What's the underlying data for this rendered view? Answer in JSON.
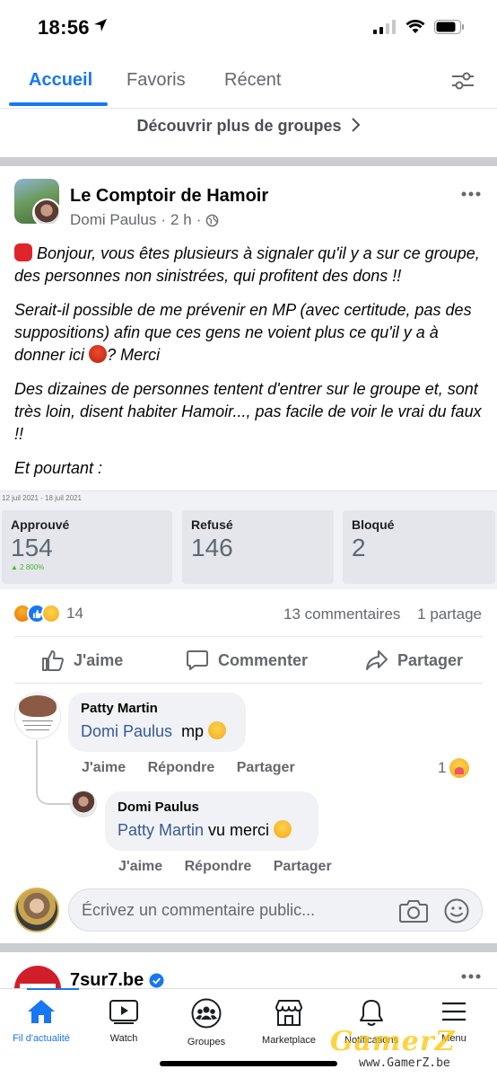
{
  "status_bar": {
    "time": "18:56"
  },
  "tabs": [
    {
      "label": "Accueil",
      "active": true
    },
    {
      "label": "Favoris",
      "active": false
    },
    {
      "label": "Récent",
      "active": false
    }
  ],
  "discover": {
    "label": "Découvrir plus de groupes"
  },
  "post": {
    "group_name": "Le Comptoir de Hamoir",
    "author": "Domi Paulus",
    "time": "2 h",
    "paragraphs": [
      "Bonjour, vous êtes plusieurs à signaler qu'il y a sur ce groupe, des personnes non sinistrées, qui profitent des dons !!",
      "Serait-il possible de me prévenir en MP (avec certitude, pas des suppositions) afin que ces gens ne voient plus ce qu'il y a à donner ici",
      "? Merci",
      "Des dizaines de personnes tentent d'entrer sur le groupe et, sont très loin, disent habiter Hamoir..., pas facile de voir le vrai du faux !!",
      "Et pourtant :"
    ],
    "stats_image": {
      "date_range": "12 juil 2021 - 18 juil 2021",
      "cards": [
        {
          "label": "Approuvé",
          "value": "154",
          "change": "▲ 2 800%"
        },
        {
          "label": "Refusé",
          "value": "146",
          "change": ""
        },
        {
          "label": "Bloqué",
          "value": "2",
          "change": ""
        }
      ]
    },
    "reaction_count": "14",
    "comments_count": "13 commentaires",
    "shares_count": "1 partage",
    "actions": {
      "like": "J'aime",
      "comment": "Commenter",
      "share": "Partager"
    }
  },
  "comments": [
    {
      "name": "Patty Martin",
      "mention": "Domi Paulus",
      "text": "mp",
      "actions": [
        "J'aime",
        "Répondre",
        "Partager"
      ],
      "reaction_count": "1"
    },
    {
      "name": "Domi Paulus",
      "mention": "Patty Martin",
      "text": "vu merci",
      "actions": [
        "J'aime",
        "Répondre",
        "Partager"
      ]
    }
  ],
  "composer": {
    "placeholder": "Écrivez un commentaire public..."
  },
  "next_post": {
    "name": "7sur7.be"
  },
  "bottom_nav": [
    {
      "label": "Fil d'actualité",
      "icon": "home-icon",
      "active": true
    },
    {
      "label": "Watch",
      "icon": "watch-icon",
      "active": false
    },
    {
      "label": "Groupes",
      "icon": "groups-icon",
      "active": false
    },
    {
      "label": "Marketplace",
      "icon": "marketplace-icon",
      "active": false
    },
    {
      "label": "Notifications",
      "icon": "bell-icon",
      "active": false
    },
    {
      "label": "Menu",
      "icon": "menu-icon",
      "active": false
    }
  ],
  "watermark": {
    "brand": "GamerZ",
    "url": "www.GamerZ.be"
  },
  "colors": {
    "accent": "#1877f2",
    "secondary_text": "#65676b",
    "mention": "#385898",
    "like_green": "#42b72a"
  }
}
